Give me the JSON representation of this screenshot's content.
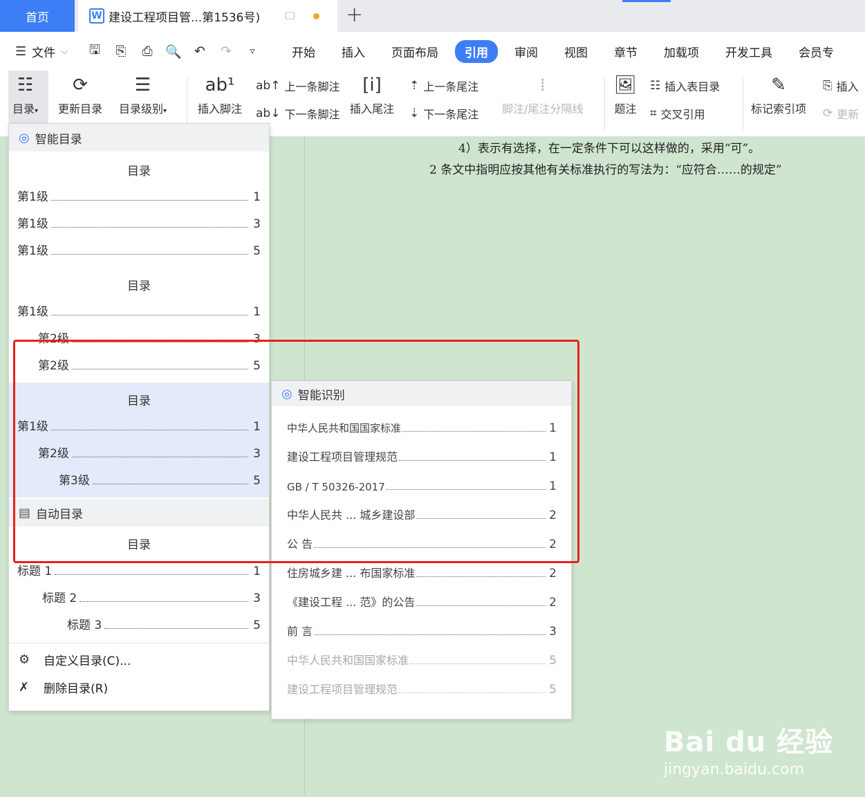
{
  "tabs": {
    "home": "首页",
    "doc_title": "建设工程项目管...第1536号)",
    "wps_letter": "W",
    "plus": "+"
  },
  "menubar": {
    "hamburger": "☰",
    "file": "文件",
    "tabs": [
      "开始",
      "插入",
      "页面布局",
      "引用",
      "审阅",
      "视图",
      "章节",
      "加载项",
      "开发工具",
      "会员专"
    ],
    "active_tab": "引用"
  },
  "ribbon": {
    "toc": "目录",
    "update_toc": "更新目录",
    "toc_level": "目录级别",
    "insert_footnote": "插入脚注",
    "footnote_icon": "ab¹",
    "prev_footnote": "上一条脚注",
    "next_footnote": "下一条脚注",
    "insert_endnote": "插入尾注",
    "prev_endnote": "上一条尾注",
    "next_endnote": "下一条尾注",
    "separator": "脚注/尾注分隔线",
    "caption": "题注",
    "insert_table_toc": "插入表目录",
    "cross_ref": "交叉引用",
    "mark_index": "标记索引项",
    "insert_index": "插入",
    "update_index": "更新"
  },
  "document": {
    "line1": "4）表示有选择，在一定条件下可以这样做的，采用“可”。",
    "line2": "2  条文中指明应按其他有关标准执行的写法为：“应符合……的规定”"
  },
  "dropdown": {
    "smart_toc_header": "智能目录",
    "toc_title": "目录",
    "style1": [
      {
        "label": "第1级",
        "page": "1"
      },
      {
        "label": "第1级",
        "page": "3"
      },
      {
        "label": "第1级",
        "page": "5"
      }
    ],
    "style2": [
      {
        "label": "第1级",
        "page": "1"
      },
      {
        "label": "第2级",
        "page": "3"
      },
      {
        "label": "第2级",
        "page": "5"
      }
    ],
    "style3": [
      {
        "label": "第1级",
        "page": "1"
      },
      {
        "label": "第2级",
        "page": "3"
      },
      {
        "label": "第3级",
        "page": "5"
      }
    ],
    "auto_toc_header": "自动目录",
    "auto_toc": [
      {
        "label": "标题 1",
        "page": "1"
      },
      {
        "label": "标题 2",
        "page": "3"
      },
      {
        "label": "标题 3",
        "page": "5"
      }
    ],
    "custom_toc": "自定义目录(C)...",
    "delete_toc": "删除目录(R)"
  },
  "smart_recognition": {
    "header": "智能识别",
    "items": [
      {
        "label": "中华人民共和国国家标准",
        "page": "1"
      },
      {
        "label": "建设工程项目管理规范",
        "page": "1"
      },
      {
        "label": "GB / T 50326-2017",
        "page": "1"
      },
      {
        "label": "中华人民共    ...    城乡建设部",
        "page": "2"
      },
      {
        "label": "公    告",
        "page": "2"
      },
      {
        "label": "住房城乡建    ...    布国家标准",
        "page": "2"
      },
      {
        "label": "《建设工程    ...    范》的公告",
        "page": "2"
      },
      {
        "label": "前    言",
        "page": "3"
      },
      {
        "label": "中华人民共和国国家标准",
        "page": "5"
      },
      {
        "label": "建设工程项目管理规范",
        "page": "5"
      }
    ]
  },
  "watermark": {
    "logo": "Bai du 经验",
    "url": "jingyan.baidu.com"
  },
  "colors": {
    "accent": "#3d7ef6",
    "highlight_box": "#e2231a",
    "doc_bg": "#cfe5cf"
  }
}
